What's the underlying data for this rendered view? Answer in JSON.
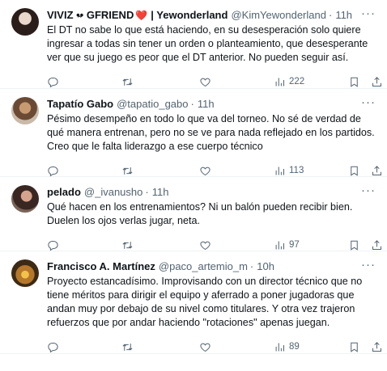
{
  "tweets": [
    {
      "name": "VIVIZ •̴• GFRIEND",
      "emoji": "❤️",
      "sep": "| Yewonderland",
      "handle": "@KimYewonderland",
      "dot": "·",
      "time": "11h",
      "text": "El DT no sabe lo que está haciendo, en su desesperación solo quiere ingresar a todas sin tener un orden o planteamiento, que desesperante ver que su juego es peor que el DT anterior. No pueden seguir así.",
      "views": "222"
    },
    {
      "name": "Tapatío Gabo",
      "handle": "@tapatio_gabo",
      "dot": "·",
      "time": "11h",
      "text": "Pésimo desempeño en todo lo que va del torneo. No sé de verdad de qué manera entrenan, pero no se ve para nada reflejado en los partidos. Creo que le falta liderazgo a ese cuerpo técnico",
      "views": "113"
    },
    {
      "name": "pelado",
      "handle": "@_ivanusho",
      "dot": "·",
      "time": "11h",
      "text": "Qué hacen en los entrenamientos? Ni un balón pueden recibir bien. Duelen los ojos verlas jugar, neta.",
      "views": "97"
    },
    {
      "name": "Francisco A. Martínez",
      "handle": "@paco_artemio_m",
      "dot": "·",
      "time": "10h",
      "text": "Proyecto estancadísimo. Improvisando con un director técnico que no tiene méritos para dirigir el equipo y aferrado a poner jugadoras que andan muy por debajo de su nivel como titulares. Y otra vez trajeron refuerzos que por andar haciendo \"rotaciones\" apenas juegan.",
      "views": "89"
    }
  ],
  "more_glyph": "···",
  "icons": [
    "reply-icon",
    "retweet-icon",
    "like-icon",
    "views-icon",
    "bookmark-icon",
    "share-icon"
  ]
}
